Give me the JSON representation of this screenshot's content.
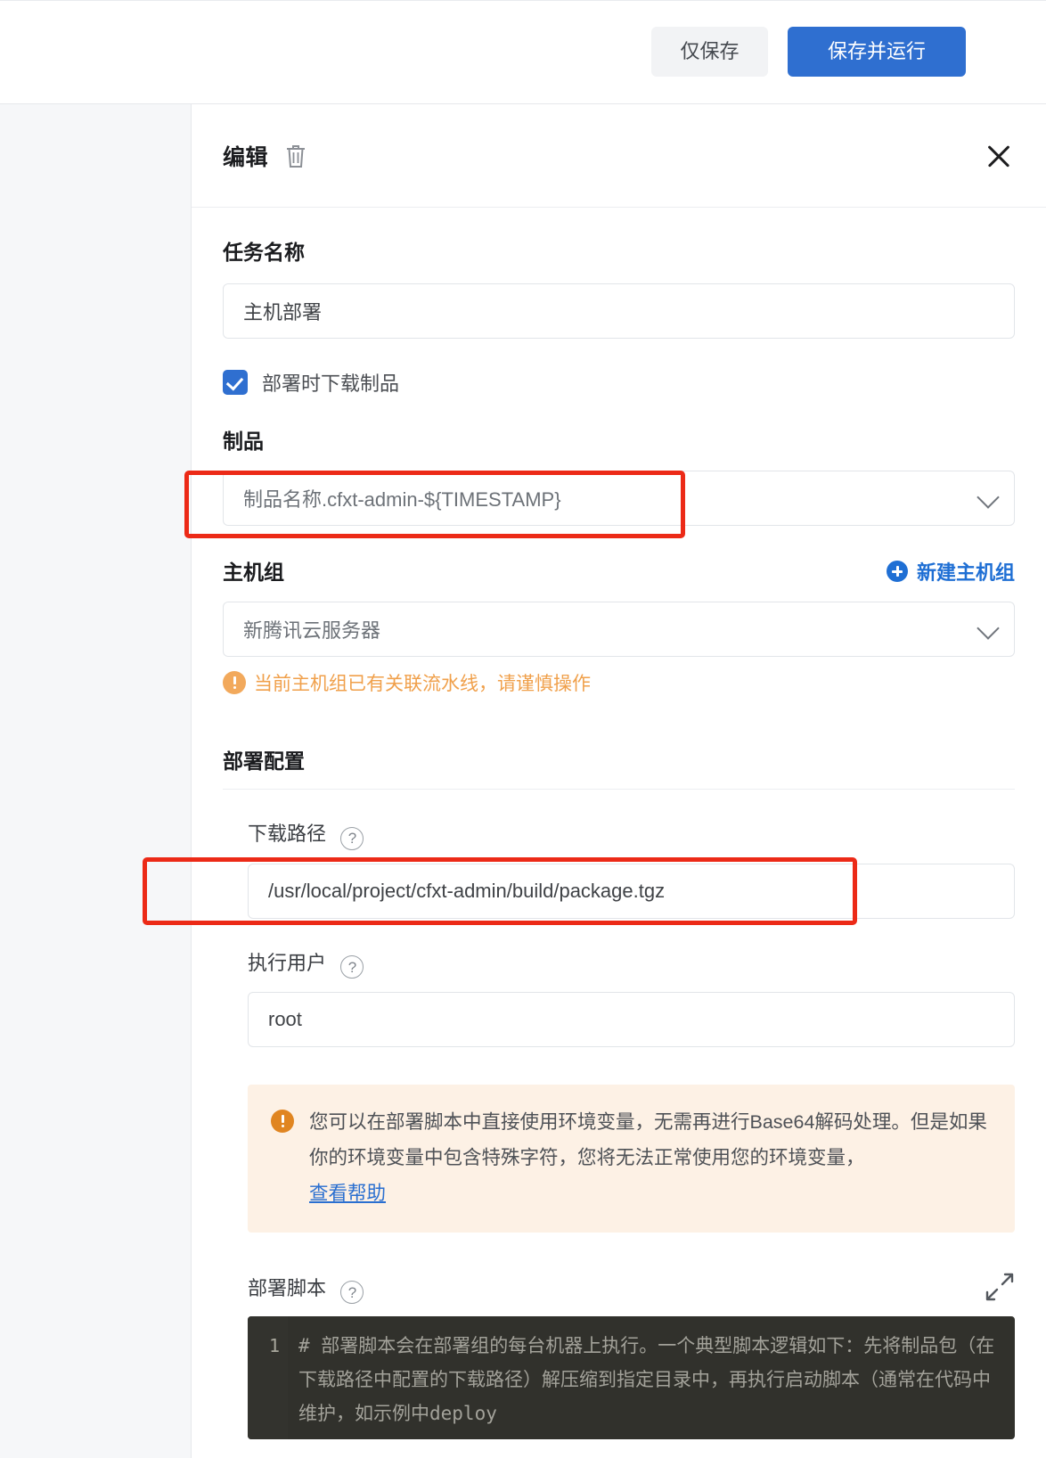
{
  "toolbar": {
    "save_only_label": "仅保存",
    "save_and_run_label": "保存并运行"
  },
  "panel": {
    "title": "编辑",
    "delete_icon": "trash-icon",
    "close_icon": "close-icon"
  },
  "form": {
    "task_name": {
      "label": "任务名称",
      "value": "主机部署"
    },
    "download_artifact_checkbox": {
      "label": "部署时下载制品",
      "checked": true
    },
    "artifact": {
      "label": "制品",
      "value": "制品名称.cfxt-admin-${TIMESTAMP}"
    },
    "host_group": {
      "label": "主机组",
      "add_link": "新建主机组",
      "value": "新腾讯云服务器",
      "warning": "当前主机组已有关联流水线，请谨慎操作"
    },
    "deploy_config": {
      "section_title": "部署配置",
      "download_path": {
        "label": "下载路径",
        "help": "?",
        "value": "/usr/local/project/cfxt-admin/build/package.tgz"
      },
      "exec_user": {
        "label": "执行用户",
        "help": "?",
        "value": "root"
      },
      "env_alert": {
        "text": "您可以在部署脚本中直接使用环境变量，无需再进行Base64解码处理。但是如果你的环境变量中包含特殊字符，您将无法正常使用您的环境变量，",
        "link": "查看帮助"
      },
      "deploy_script": {
        "label": "部署脚本",
        "help": "?",
        "expand_icon": "expand-arrows-icon",
        "line_number": "1",
        "code": "# 部署脚本会在部署组的每台机器上执行。一个典型脚本逻辑如下：先将制品包（在下载路径中配置的下载路径）解压缩到指定目录中，再执行启动脚本（通常在代码中维护，如示例中deploy"
      }
    }
  },
  "annotations": {
    "artifact_highlight_color": "#ec2a17",
    "download_path_highlight_color": "#ec2a17"
  }
}
